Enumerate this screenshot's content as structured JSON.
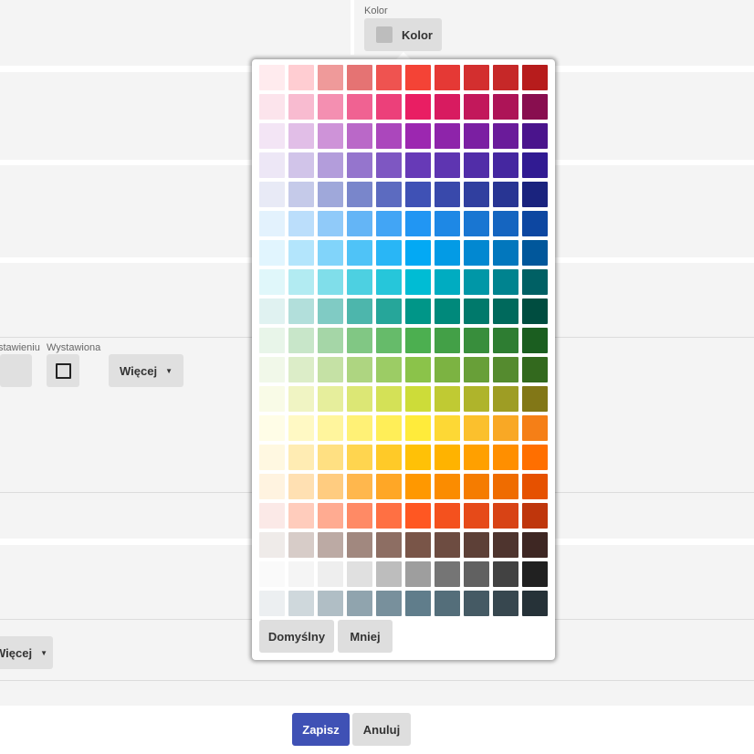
{
  "color_field": {
    "label": "Kolor",
    "button_label": "Kolor",
    "current_color": "#bdbdbd"
  },
  "fields": {
    "partial_label": "stawieniu",
    "issued_label": "Wystawiona",
    "more_label": "Więcej",
    "more_label_2": "Więcej"
  },
  "palette": {
    "rows": [
      [
        "#ffebee",
        "#ffcdd2",
        "#ef9a9a",
        "#e57373",
        "#ef5350",
        "#f44336",
        "#e53935",
        "#d32f2f",
        "#c62828",
        "#b71c1c"
      ],
      [
        "#fce4ec",
        "#f8bbd0",
        "#f48fb1",
        "#f06292",
        "#ec407a",
        "#e91e63",
        "#d81b60",
        "#c2185b",
        "#ad1457",
        "#880e4f"
      ],
      [
        "#f3e5f5",
        "#e1bee7",
        "#ce93d8",
        "#ba68c8",
        "#ab47bc",
        "#9c27b0",
        "#8e24aa",
        "#7b1fa2",
        "#6a1b9a",
        "#4a148c"
      ],
      [
        "#ede7f6",
        "#d1c4e9",
        "#b39ddb",
        "#9575cd",
        "#7e57c2",
        "#673ab7",
        "#5e35b1",
        "#512da8",
        "#4527a0",
        "#311b92"
      ],
      [
        "#e8eaf6",
        "#c5cae9",
        "#9fa8da",
        "#7986cb",
        "#5c6bc0",
        "#3f51b5",
        "#3949ab",
        "#303f9f",
        "#283593",
        "#1a237e"
      ],
      [
        "#e3f2fd",
        "#bbdefb",
        "#90caf9",
        "#64b5f6",
        "#42a5f5",
        "#2196f3",
        "#1e88e5",
        "#1976d2",
        "#1565c0",
        "#0d47a1"
      ],
      [
        "#e1f5fe",
        "#b3e5fc",
        "#81d4fa",
        "#4fc3f7",
        "#29b6f6",
        "#03a9f4",
        "#039be5",
        "#0288d1",
        "#0277bd",
        "#01579b"
      ],
      [
        "#e0f7fa",
        "#b2ebf2",
        "#80deea",
        "#4dd0e1",
        "#26c6da",
        "#00bcd4",
        "#00acc1",
        "#0097a7",
        "#00838f",
        "#006064"
      ],
      [
        "#e0f2f1",
        "#b2dfdb",
        "#80cbc4",
        "#4db6ac",
        "#26a69a",
        "#009688",
        "#00897b",
        "#00796b",
        "#00695c",
        "#004d40"
      ],
      [
        "#e8f5e9",
        "#c8e6c9",
        "#a5d6a7",
        "#81c784",
        "#66bb6a",
        "#4caf50",
        "#43a047",
        "#388e3c",
        "#2e7d32",
        "#1b5e20"
      ],
      [
        "#f1f8e9",
        "#dcedc8",
        "#c5e1a5",
        "#aed581",
        "#9ccc65",
        "#8bc34a",
        "#7cb342",
        "#689f38",
        "#558b2f",
        "#33691e"
      ],
      [
        "#f9fbe7",
        "#f0f4c3",
        "#e6ee9c",
        "#dce775",
        "#d4e157",
        "#cddc39",
        "#c0ca33",
        "#afb42b",
        "#9e9d24",
        "#827717"
      ],
      [
        "#fffde7",
        "#fff9c4",
        "#fff59d",
        "#fff176",
        "#ffee58",
        "#ffeb3b",
        "#fdd835",
        "#fbc02d",
        "#f9a825",
        "#f57f17"
      ],
      [
        "#fff8e1",
        "#ffecb3",
        "#ffe082",
        "#ffd54f",
        "#ffca28",
        "#ffc107",
        "#ffb300",
        "#ffa000",
        "#ff8f00",
        "#ff6f00"
      ],
      [
        "#fff3e0",
        "#ffe0b2",
        "#ffcc80",
        "#ffb74d",
        "#ffa726",
        "#ff9800",
        "#fb8c00",
        "#f57c00",
        "#ef6c00",
        "#e65100"
      ],
      [
        "#fbe9e7",
        "#ffccbc",
        "#ffab91",
        "#ff8a65",
        "#ff7043",
        "#ff5722",
        "#f4511e",
        "#e64a19",
        "#d84315",
        "#bf360c"
      ],
      [
        "#efebe9",
        "#d7ccc8",
        "#bcaaa4",
        "#a1887f",
        "#8d6e63",
        "#795548",
        "#6d4c41",
        "#5d4037",
        "#4e342e",
        "#3e2723"
      ],
      [
        "#fafafa",
        "#f5f5f5",
        "#eeeeee",
        "#e0e0e0",
        "#bdbdbd",
        "#9e9e9e",
        "#757575",
        "#616161",
        "#424242",
        "#212121"
      ],
      [
        "#eceff1",
        "#cfd8dc",
        "#b0bec5",
        "#90a4ae",
        "#78909c",
        "#607d8b",
        "#546e7a",
        "#455a64",
        "#37474f",
        "#263238"
      ]
    ],
    "default_label": "Domyślny",
    "less_label": "Mniej"
  },
  "actions": {
    "save_label": "Zapisz",
    "cancel_label": "Anuluj"
  },
  "colors": {
    "primary": "#3f51b5",
    "background": "#f4f4f4",
    "button": "#dedede"
  }
}
